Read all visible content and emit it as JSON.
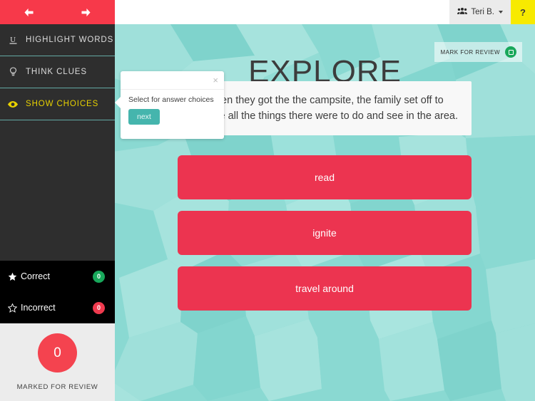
{
  "topbar": {
    "user_name": "Teri B.",
    "user_icon": "group-icon",
    "caret_icon": "chevron-down-icon",
    "help_label": "?"
  },
  "navbar": {
    "back_icon": "arrow-left-icon",
    "forward_icon": "arrow-right-icon",
    "back_label": "",
    "forward_label": ""
  },
  "sidebar": {
    "tools": [
      {
        "label": "HIGHLIGHT WORDS",
        "icon": "underline-u-icon",
        "active": false
      },
      {
        "label": "THINK CLUES",
        "icon": "lightbulb-icon",
        "active": false
      },
      {
        "label": "SHOW CHOICES",
        "icon": "eye-icon",
        "active": true
      }
    ],
    "stats": [
      {
        "label": "Correct",
        "icon": "star-filled-icon",
        "count": "0",
        "color": "#18a85b"
      },
      {
        "label": "Incorrect",
        "icon": "star-outline-icon",
        "count": "0",
        "color": "#ef3a4e"
      }
    ],
    "review": {
      "count": "0",
      "caption": "MARKED FOR REVIEW",
      "color": "#f4434f"
    }
  },
  "main": {
    "title": "EXPLORE",
    "mark_for_review_label": "MARK FOR REVIEW",
    "mark_toggle_icon": "square-toggle-icon",
    "question_text": "When they got the the campsite, the family set off to explore all the things there were to do and see in the area.",
    "choices": [
      {
        "label": "read"
      },
      {
        "label": "ignite"
      },
      {
        "label": "travel around"
      }
    ]
  },
  "popover": {
    "close_icon": "close-icon",
    "close_label": "×",
    "text": "Select for answer choices",
    "next_label": "next"
  },
  "colors": {
    "navbar_red": "#f7394a",
    "choice_red": "#ec3450",
    "teal_bg": "#8ad9d2",
    "teal_button": "#45b5ad",
    "accent_yellow": "#e8d100",
    "help_yellow": "#f7ea00",
    "sidebar_dark": "#2e2e2e",
    "stats_black": "#000000"
  }
}
